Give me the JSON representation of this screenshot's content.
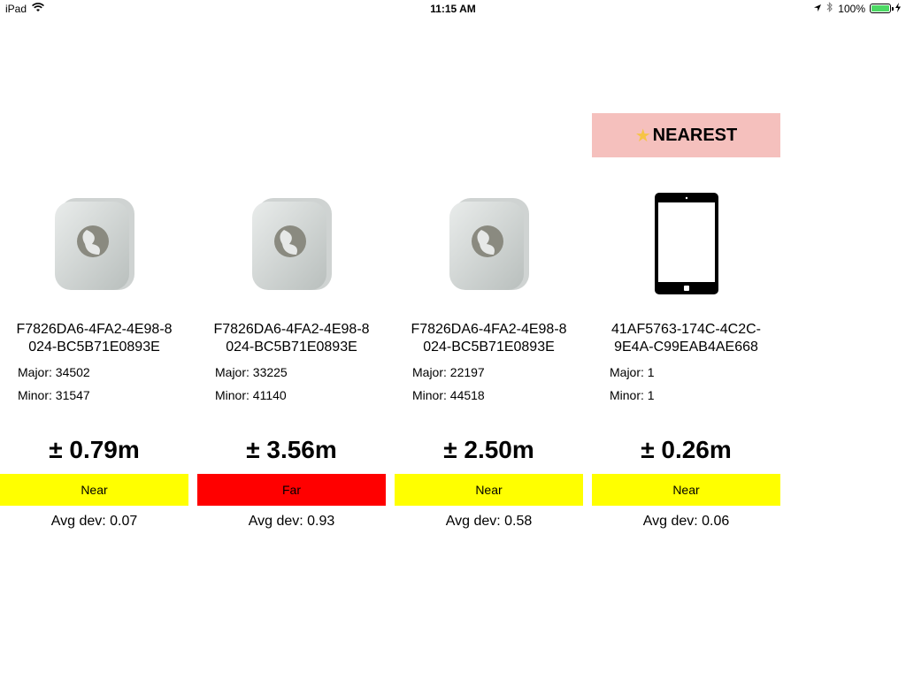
{
  "status_bar": {
    "device": "iPad",
    "time": "11:15 AM",
    "battery": "100%",
    "battery_level": 1.0,
    "icons": [
      "wifi-icon",
      "location-arrow-icon",
      "bluetooth-icon",
      "battery-icon",
      "charging-bolt-icon"
    ]
  },
  "nearest_banner": {
    "star": "★",
    "label": "NEAREST"
  },
  "beacons": [
    {
      "uuid_line1": "F7826DA6-4FA2-4E98-8",
      "uuid_line2": "024-BC5B71E0893E",
      "major": "Major: 34502",
      "minor": "Minor: 31547",
      "distance": "± 0.79m",
      "proximity": "Near",
      "proximity_color": "#ffff00",
      "avg_dev": "Avg dev: 0.07",
      "icon": "beacon-device-icon"
    },
    {
      "uuid_line1": "F7826DA6-4FA2-4E98-8",
      "uuid_line2": "024-BC5B71E0893E",
      "major": "Major: 33225",
      "minor": "Minor: 41140",
      "distance": "± 3.56m",
      "proximity": "Far",
      "proximity_color": "#ff0000",
      "avg_dev": "Avg dev: 0.93",
      "icon": "beacon-device-icon"
    },
    {
      "uuid_line1": "F7826DA6-4FA2-4E98-8",
      "uuid_line2": "024-BC5B71E0893E",
      "major": "Major: 22197",
      "minor": "Minor: 44518",
      "distance": "± 2.50m",
      "proximity": "Near",
      "proximity_color": "#ffff00",
      "avg_dev": "Avg dev: 0.58",
      "icon": "beacon-device-icon"
    },
    {
      "uuid_line1": "41AF5763-174C-4C2C-",
      "uuid_line2": "9E4A-C99EAB4AE668",
      "major": "Major: 1",
      "minor": "Minor: 1",
      "distance": "± 0.26m",
      "proximity": "Near",
      "proximity_color": "#ffff00",
      "avg_dev": "Avg dev: 0.06",
      "icon": "ipad-device-icon"
    }
  ]
}
